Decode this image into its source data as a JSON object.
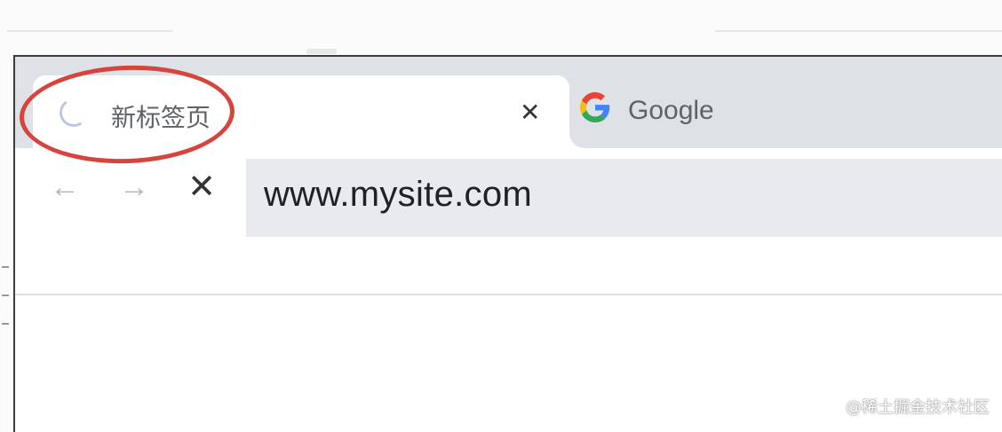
{
  "browser": {
    "active_tab": {
      "title": "新标签页",
      "icon": "loading-spinner-icon",
      "close_glyph": "✕"
    },
    "inactive_tab": {
      "title": "Google",
      "icon": "google-g-icon"
    },
    "toolbar": {
      "back_glyph": "←",
      "forward_glyph": "→",
      "stop_glyph": "✕",
      "url": "www.mysite.com"
    }
  },
  "annotation": {
    "shape": "ellipse",
    "color": "#d6453d",
    "target": "active-tab-title"
  },
  "watermark": {
    "text": "@稀土掘金技术社区"
  },
  "colors": {
    "tabstrip": "#dee1e6",
    "omnibox": "#e8eaed",
    "spinner": "#b9c6e8"
  }
}
